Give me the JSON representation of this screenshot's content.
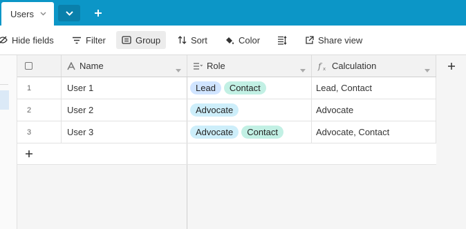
{
  "tabs": {
    "active_label": "Users"
  },
  "toolbar": {
    "hide_fields": "Hide fields",
    "filter": "Filter",
    "group": "Group",
    "sort": "Sort",
    "color": "Color",
    "share_view": "Share view"
  },
  "table": {
    "headers": {
      "name": "Name",
      "role": "Role",
      "calculation": "Calculation"
    },
    "rows": [
      {
        "num": "1",
        "name": "User 1",
        "roles": [
          "Lead",
          "Contact"
        ],
        "calculation": "Lead, Contact"
      },
      {
        "num": "2",
        "name": "User 2",
        "roles": [
          "Advocate"
        ],
        "calculation": "Advocate"
      },
      {
        "num": "3",
        "name": "User 3",
        "roles": [
          "Advocate",
          "Contact"
        ],
        "calculation": "Advocate, Contact"
      }
    ]
  },
  "colors": {
    "tabbar": "#0c96c7",
    "pill_lead": "#d0e4ff",
    "pill_contact": "#c2f0e4",
    "pill_advocate": "#cdeefa"
  }
}
